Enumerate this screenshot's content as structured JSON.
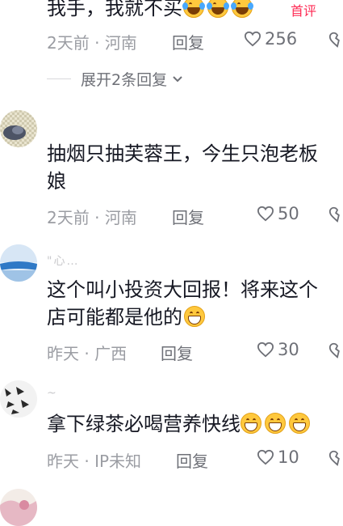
{
  "comments": [
    {
      "text": "我手，我就不买",
      "emoji_count": 3,
      "emoji": "laugh-cry",
      "badge": "首评",
      "time": "2天前",
      "location": "河南",
      "reply_label": "回复",
      "likes": "256",
      "expand_label": "展开2条回复"
    },
    {
      "line1": "抽烟只抽芙蓉王，今生只泡老板",
      "line2": "娘",
      "time": "2天前",
      "location": "河南",
      "reply_label": "回复",
      "likes": "50"
    },
    {
      "username": "\"心…",
      "line1": "这个叫小投资大回报！将来这个",
      "line2": "店可能都是他的",
      "emoji": "grin",
      "time": "昨天",
      "location": "广西",
      "reply_label": "回复",
      "likes": "30"
    },
    {
      "username": "~",
      "text": "拿下绿茶必喝营养快线",
      "emoji": "grin",
      "emoji_count": 3,
      "time": "昨天",
      "location": "IP未知",
      "reply_label": "回复",
      "likes": "10"
    }
  ],
  "separator": "·"
}
